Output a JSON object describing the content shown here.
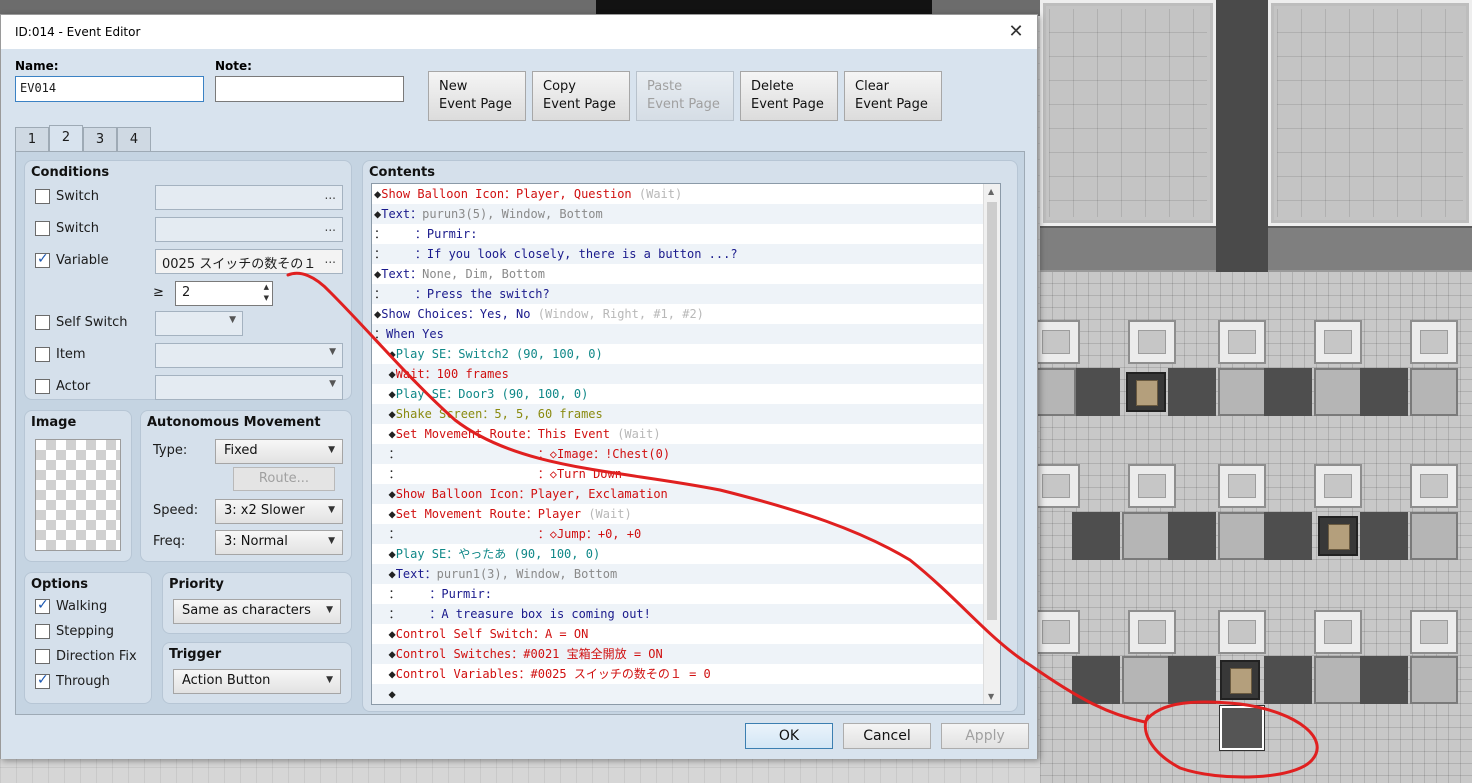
{
  "window": {
    "title": "ID:014 - Event Editor",
    "close_glyph": "✕"
  },
  "name": {
    "label": "Name:",
    "value": "EV014"
  },
  "note": {
    "label": "Note:",
    "value": ""
  },
  "toolbar": {
    "new_l1": "New",
    "new_l2": "Event Page",
    "copy_l1": "Copy",
    "copy_l2": "Event Page",
    "paste_l1": "Paste",
    "paste_l2": "Event Page",
    "delete_l1": "Delete",
    "delete_l2": "Event Page",
    "clear_l1": "Clear",
    "clear_l2": "Event Page"
  },
  "tabs": [
    "1",
    "2",
    "3",
    "4"
  ],
  "active_tab": "2",
  "conditions": {
    "title": "Conditions",
    "switch1": {
      "label": "Switch",
      "checked": false,
      "value": "",
      "glyph": "..."
    },
    "switch2": {
      "label": "Switch",
      "checked": false,
      "value": "",
      "glyph": "..."
    },
    "variable": {
      "label": "Variable",
      "checked": true,
      "value": "0025 スイッチの数その１",
      "glyph": "...",
      "operator": "≥",
      "amount": "2"
    },
    "self_switch": {
      "label": "Self Switch",
      "checked": false,
      "value": ""
    },
    "item": {
      "label": "Item",
      "checked": false,
      "value": ""
    },
    "actor": {
      "label": "Actor",
      "checked": false,
      "value": ""
    }
  },
  "image": {
    "title": "Image"
  },
  "movement": {
    "title": "Autonomous Movement",
    "type_label": "Type:",
    "type_value": "Fixed",
    "route_button": "Route...",
    "speed_label": "Speed:",
    "speed_value": "3: x2 Slower",
    "freq_label": "Freq:",
    "freq_value": "3: Normal"
  },
  "options": {
    "title": "Options",
    "walking": {
      "label": "Walking",
      "checked": true
    },
    "stepping": {
      "label": "Stepping",
      "checked": false
    },
    "direction_fix": {
      "label": "Direction Fix",
      "checked": false
    },
    "through": {
      "label": "Through",
      "checked": true
    }
  },
  "priority": {
    "title": "Priority",
    "value": "Same as characters"
  },
  "trigger": {
    "title": "Trigger",
    "value": "Action Button"
  },
  "contents": {
    "title": "Contents",
    "rows": [
      {
        "indent": "",
        "bullet": "◆",
        "cmd": "Show Balloon Icon：Player, Question",
        "extra": " (Wait)",
        "color": "#d01010"
      },
      {
        "indent": "",
        "bullet": "◆",
        "cmd": "Text：",
        "extra": "purun3(5), Window, Bottom",
        "color": "#1a1a8c"
      },
      {
        "indent": "：    ",
        "bullet": "",
        "cmd": "：Purmir:",
        "extra": "",
        "color": "#1a1a8c"
      },
      {
        "indent": "：    ",
        "bullet": "",
        "cmd": "：If you look closely, there is a button ...?",
        "extra": "",
        "color": "#1a1a8c"
      },
      {
        "indent": "",
        "bullet": "◆",
        "cmd": "Text：",
        "extra": "None, Dim, Bottom",
        "color": "#1a1a8c"
      },
      {
        "indent": "：    ",
        "bullet": "",
        "cmd": "：Press the switch?",
        "extra": "",
        "color": "#1a1a8c"
      },
      {
        "indent": "",
        "bullet": "◆",
        "cmd": "Show Choices：Yes, No",
        "extra": " (Window, Right, #1, #2)",
        "color": "#1a1a8c"
      },
      {
        "indent": "：",
        "bullet": "",
        "cmd": "When Yes",
        "extra": "",
        "color": "#1a1a8c"
      },
      {
        "indent": "  ",
        "bullet": "◆",
        "cmd": "Play SE：Switch2 (90, 100, 0)",
        "extra": "",
        "color": "#108888"
      },
      {
        "indent": "  ",
        "bullet": "◆",
        "cmd": "Wait：100 frames",
        "extra": "",
        "color": "#d01010"
      },
      {
        "indent": "  ",
        "bullet": "◆",
        "cmd": "Play SE：Door3 (90, 100, 0)",
        "extra": "",
        "color": "#108888"
      },
      {
        "indent": "  ",
        "bullet": "◆",
        "cmd": "Shake Screen：5, 5, 60 frames",
        "extra": "",
        "color": "#8a8a10"
      },
      {
        "indent": "  ",
        "bullet": "◆",
        "cmd": "Set Movement Route：This Event",
        "extra": " (Wait)",
        "color": "#d01010"
      },
      {
        "indent": "  ：                   ",
        "bullet": "",
        "cmd": "：◇Image：!Chest(0)",
        "extra": "",
        "color": "#d01010"
      },
      {
        "indent": "  ：                   ",
        "bullet": "",
        "cmd": "：◇Turn Down",
        "extra": "",
        "color": "#d01010"
      },
      {
        "indent": "  ",
        "bullet": "◆",
        "cmd": "Show Balloon Icon：Player, Exclamation",
        "extra": "",
        "color": "#d01010"
      },
      {
        "indent": "  ",
        "bullet": "◆",
        "cmd": "Set Movement Route：Player",
        "extra": " (Wait)",
        "color": "#d01010"
      },
      {
        "indent": "  ：                   ",
        "bullet": "",
        "cmd": "：◇Jump：+0, +0",
        "extra": "",
        "color": "#d01010"
      },
      {
        "indent": "  ",
        "bullet": "◆",
        "cmd": "Play SE：やったあ (90, 100, 0)",
        "extra": "",
        "color": "#108888"
      },
      {
        "indent": "  ",
        "bullet": "◆",
        "cmd": "Text：",
        "extra": "purun1(3), Window, Bottom",
        "color": "#1a1a8c"
      },
      {
        "indent": "  ：    ",
        "bullet": "",
        "cmd": "：Purmir:",
        "extra": "",
        "color": "#1a1a8c"
      },
      {
        "indent": "  ：    ",
        "bullet": "",
        "cmd": "：A treasure box is coming out!",
        "extra": "",
        "color": "#1a1a8c"
      },
      {
        "indent": "  ",
        "bullet": "◆",
        "cmd": "Control Self Switch：A = ON",
        "extra": "",
        "color": "#d01010"
      },
      {
        "indent": "  ",
        "bullet": "◆",
        "cmd": "Control Switches：#0021 宝箱全開放 = ON",
        "extra": "",
        "color": "#d01010"
      },
      {
        "indent": "  ",
        "bullet": "◆",
        "cmd": "Control Variables：#0025 スイッチの数その１ = 0",
        "extra": "",
        "color": "#d01010"
      },
      {
        "indent": "  ",
        "bullet": "◆",
        "cmd": "",
        "extra": "",
        "color": "#222222"
      }
    ]
  },
  "footer": {
    "ok": "OK",
    "cancel": "Cancel",
    "apply": "Apply"
  },
  "scroll": {
    "up_glyph": "▲",
    "down_glyph": "▼"
  },
  "annotation": {
    "color": "#e02020"
  }
}
